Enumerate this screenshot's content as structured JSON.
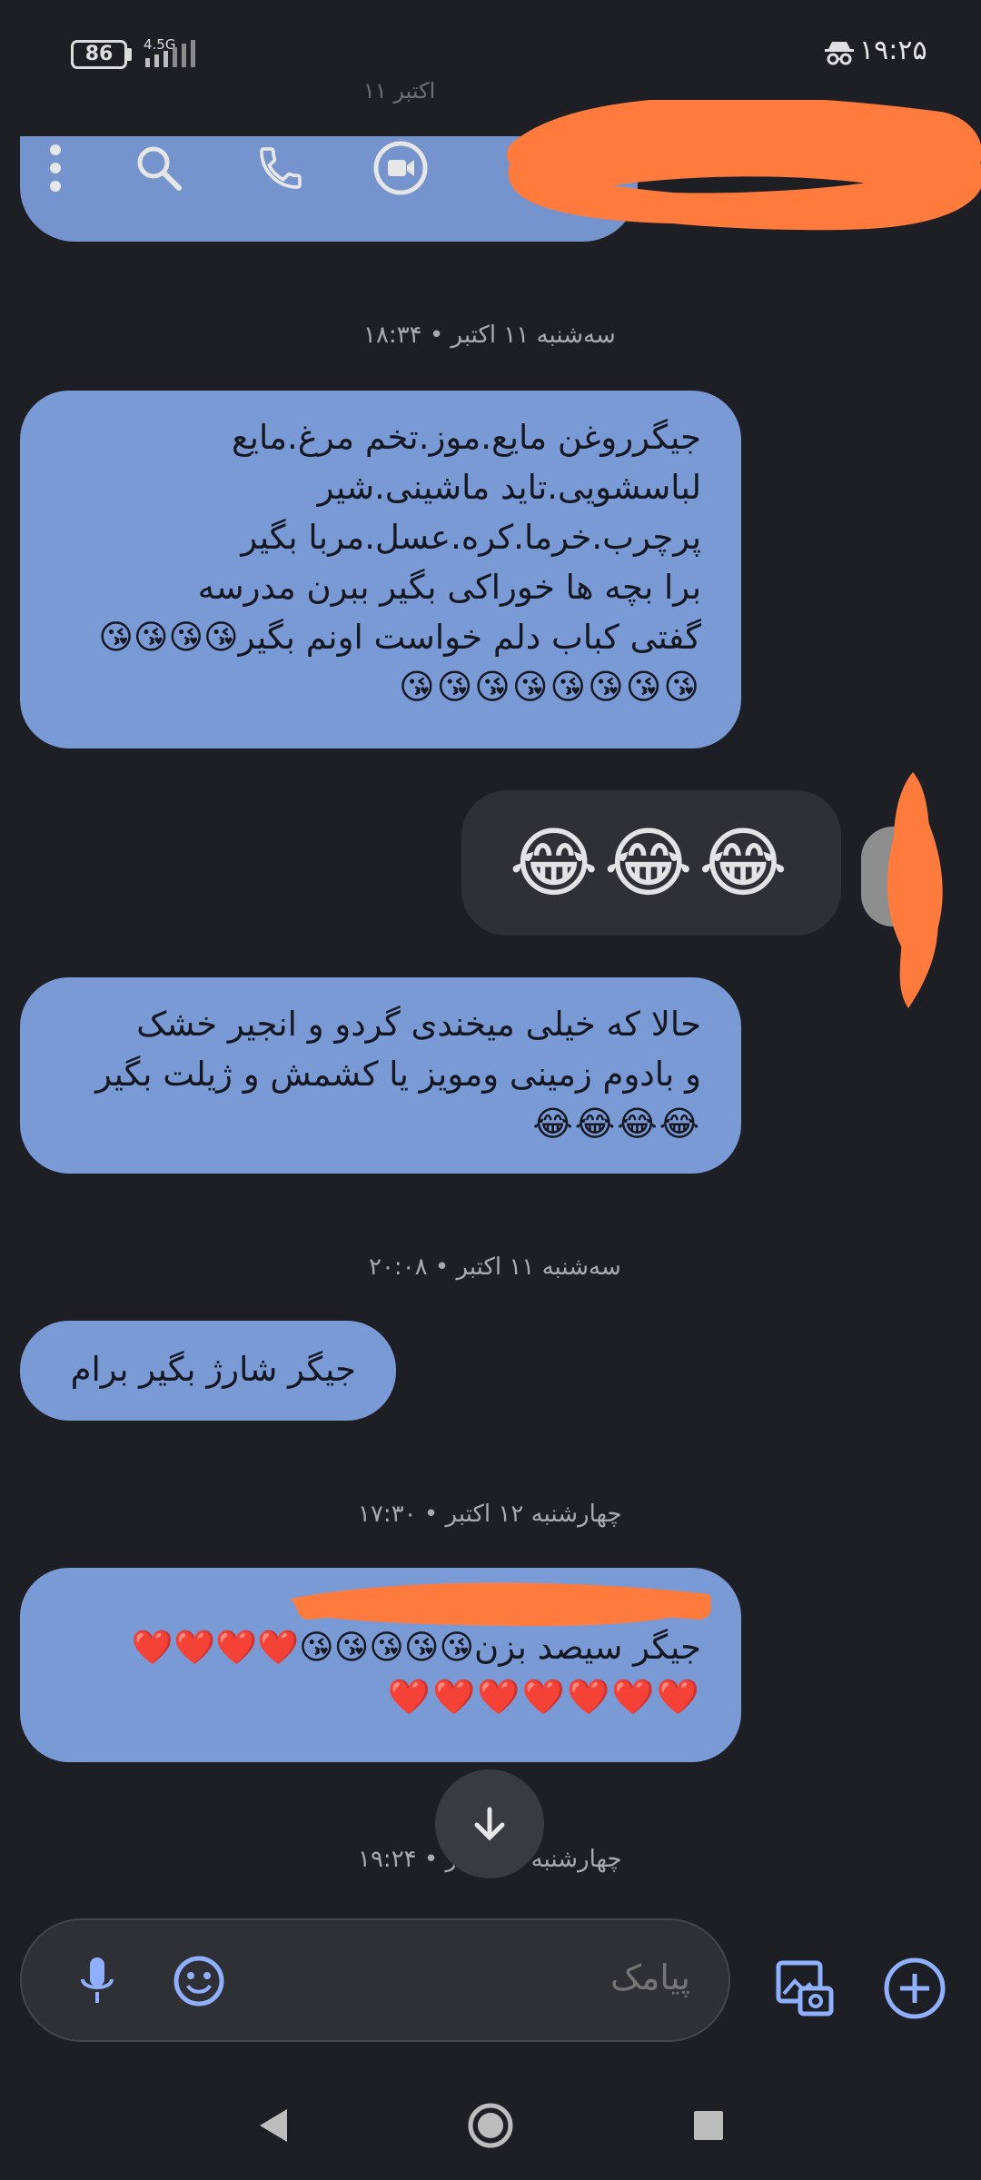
{
  "status_bar": {
    "battery": "86",
    "network": "4.5G",
    "time": "۱۹:۲۵"
  },
  "header": {
    "contact_name_redacted": true
  },
  "peek": {
    "timestamp": "۱۱ اکتبر"
  },
  "messages": [
    {
      "type": "timestamp",
      "text": "سه‌شنبه ۱۱ اکتبر • ۱۸:۳۴"
    },
    {
      "type": "incoming",
      "lines": [
        "جیگرروغن مایع.موز.تخم مرغ.مایع",
        "لباسشویی.تاید ماشینی.شیر",
        "پرچرب.خرما.کره.عسل.مربا بگیر",
        "برا بچه ها خوراکی بگیر ببرن مدرسه",
        "گفتی کباب دلم خواست اونم بگیر😘😘😘😘",
        "😘😘😘😘😘😘😘😘"
      ]
    },
    {
      "type": "outgoing",
      "text": "😂😂😂"
    },
    {
      "type": "incoming",
      "lines": [
        "حالا که خیلی میخندی گردو و انجیر خشک",
        "و بادوم زمینی ومویز یا کشمش و ژیلت بگیر",
        "😂😂😂😂"
      ]
    },
    {
      "type": "timestamp",
      "text": "سه‌شنبه ۱۱ اکتبر • ۲۰:۰۸"
    },
    {
      "type": "incoming",
      "lines": [
        "جیگر شارژ بگیر برام"
      ]
    },
    {
      "type": "timestamp",
      "text": "چهارشنبه ۱۲ اکتبر • ۱۷:۳۰"
    },
    {
      "type": "incoming",
      "lines": [
        "",
        "جیگر سیصد بزن😘😘😘😘😘❤️❤️❤️❤️",
        "❤️❤️❤️❤️❤️❤️❤️"
      ]
    },
    {
      "type": "timestamp",
      "text": "چهارشنبه ۱۲ اکتبر • ۱۹:۲۴"
    }
  ],
  "compose": {
    "placeholder": "پیامک"
  },
  "colors": {
    "background": "#1e1f24",
    "incoming_bubble": "#7a9ad6",
    "outgoing_bubble": "#2f3035",
    "accent": "#8fb0ff",
    "redaction": "#ff7a3d"
  }
}
